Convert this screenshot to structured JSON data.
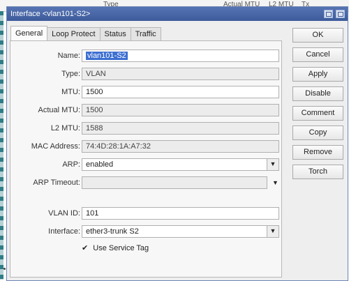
{
  "background": {
    "col1": "Type",
    "col2": "Actual MTU",
    "col3": "L2 MTU",
    "col4": "Tx"
  },
  "window": {
    "title": "Interface <vlan101-S2>"
  },
  "tabs": [
    "General",
    "Loop Protect",
    "Status",
    "Traffic"
  ],
  "fields": {
    "name": {
      "label": "Name:",
      "value": "vlan101-S2"
    },
    "type": {
      "label": "Type:",
      "value": "VLAN"
    },
    "mtu": {
      "label": "MTU:",
      "value": "1500"
    },
    "actual_mtu": {
      "label": "Actual MTU:",
      "value": "1500"
    },
    "l2_mtu": {
      "label": "L2 MTU:",
      "value": "1588"
    },
    "mac": {
      "label": "MAC Address:",
      "value": "74:4D:28:1A:A7:32"
    },
    "arp": {
      "label": "ARP:",
      "value": "enabled"
    },
    "arp_timeout": {
      "label": "ARP Timeout:",
      "value": ""
    },
    "vlan_id": {
      "label": "VLAN ID:",
      "value": "101"
    },
    "interface": {
      "label": "Interface:",
      "value": "ether3-trunk S2"
    },
    "use_service_tag": {
      "label": "Use Service Tag",
      "checked": true
    }
  },
  "buttons": {
    "ok": "OK",
    "cancel": "Cancel",
    "apply": "Apply",
    "disable": "Disable",
    "comment": "Comment",
    "copy": "Copy",
    "remove": "Remove",
    "torch": "Torch"
  },
  "colors": {
    "titlebar": "#4a68a8",
    "selection": "#3d6fd1"
  }
}
